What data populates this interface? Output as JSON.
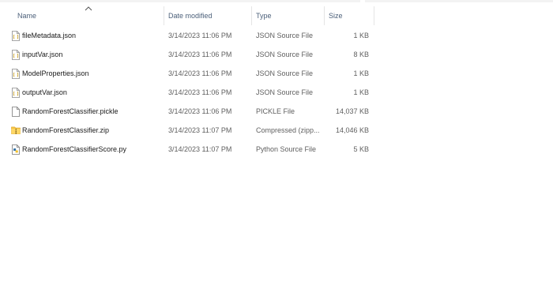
{
  "columns": {
    "name": "Name",
    "date": "Date modified",
    "type": "Type",
    "size": "Size"
  },
  "files": [
    {
      "name": "fileMetadata.json",
      "date": "3/14/2023 11:06 PM",
      "type": "JSON Source File",
      "size": "1 KB",
      "icon": "json-file-icon"
    },
    {
      "name": "inputVar.json",
      "date": "3/14/2023 11:06 PM",
      "type": "JSON Source File",
      "size": "8 KB",
      "icon": "json-file-icon"
    },
    {
      "name": "ModelProperties.json",
      "date": "3/14/2023 11:06 PM",
      "type": "JSON Source File",
      "size": "1 KB",
      "icon": "json-file-icon"
    },
    {
      "name": "outputVar.json",
      "date": "3/14/2023 11:06 PM",
      "type": "JSON Source File",
      "size": "1 KB",
      "icon": "json-file-icon"
    },
    {
      "name": "RandomForestClassifier.pickle",
      "date": "3/14/2023 11:06 PM",
      "type": "PICKLE File",
      "size": "14,037 KB",
      "icon": "generic-file-icon"
    },
    {
      "name": "RandomForestClassifier.zip",
      "date": "3/14/2023 11:07 PM",
      "type": "Compressed (zipp...",
      "size": "14,046 KB",
      "icon": "zip-folder-icon"
    },
    {
      "name": "RandomForestClassifierScore.py",
      "date": "3/14/2023 11:07 PM",
      "type": "Python Source File",
      "size": "5 KB",
      "icon": "python-file-icon"
    }
  ]
}
